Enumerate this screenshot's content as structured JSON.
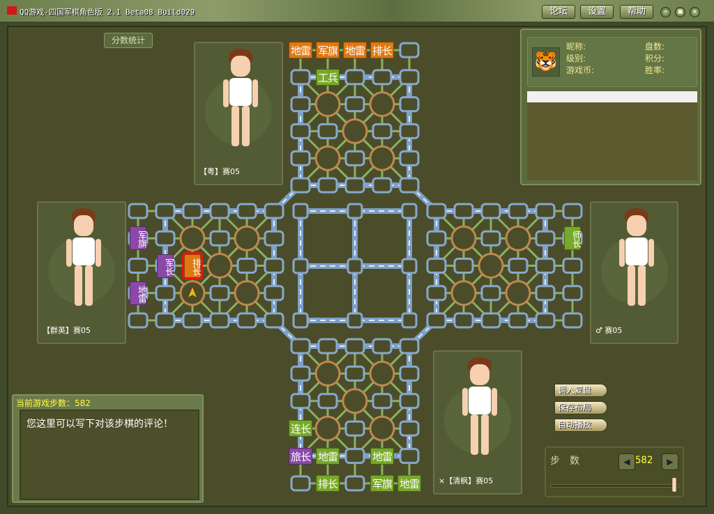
{
  "title": "QQ游戏-四国军棋角色版 2.1 Beta08 Build029",
  "top_buttons": [
    "论坛",
    "设置",
    "帮助"
  ],
  "window_controls": {
    "minimize": "−",
    "restore": "▣",
    "close": "×"
  },
  "score_button": "分数统计",
  "players": {
    "top": {
      "name": "【粤】赛05"
    },
    "left": {
      "name": "【群英】赛05"
    },
    "right": {
      "name": "♂ 赛05"
    },
    "bottom": {
      "name": "×【清枫】赛05"
    }
  },
  "info_panel": {
    "nickname": "昵称:",
    "games": "盘数:",
    "level": "级别:",
    "score": "积分:",
    "coins": "游戏币:",
    "winrate": "胜率:",
    "pet_icon": "🐯"
  },
  "comment": {
    "header": "当前游戏步数：582",
    "text": "您这里可以写下对该步棋的评论！"
  },
  "actions": [
    "调入复盘",
    "保存布局",
    "自动播放"
  ],
  "steps": {
    "label": "步　数",
    "value": "582",
    "prev": "◀",
    "next": "▶",
    "progress": 1.0
  },
  "colors": {
    "orange": "#e07810",
    "purple": "#8a48a8",
    "green": "#78a828"
  },
  "pieces": [
    {
      "label": "地雷",
      "color": "orange",
      "region": "top",
      "c": 0,
      "r": 0
    },
    {
      "label": "军旗",
      "color": "orange",
      "region": "top",
      "c": 1,
      "r": 0
    },
    {
      "label": "地雷",
      "color": "orange",
      "region": "top",
      "c": 2,
      "r": 0
    },
    {
      "label": "排长",
      "color": "orange",
      "region": "top",
      "c": 3,
      "r": 0
    },
    {
      "label": "工兵",
      "color": "green",
      "region": "top",
      "c": 1,
      "r": 1
    },
    {
      "label": "军旗",
      "color": "purple",
      "region": "left",
      "c": 0,
      "r": 1
    },
    {
      "label": "军长",
      "color": "purple",
      "region": "left",
      "c": 1,
      "r": 2
    },
    {
      "label": "地雷",
      "color": "purple",
      "region": "left",
      "c": 0,
      "r": 3
    },
    {
      "label": "排长",
      "color": "orange",
      "region": "left",
      "c": 2,
      "r": 2,
      "selected": true
    },
    {
      "label": "师长",
      "color": "green",
      "region": "right",
      "c": 5,
      "r": 1
    },
    {
      "label": "连长",
      "color": "green",
      "region": "bottom",
      "c": 0,
      "r": 3
    },
    {
      "label": "旅长",
      "color": "purple",
      "region": "bottom",
      "c": 0,
      "r": 4
    },
    {
      "label": "地雷",
      "color": "green",
      "region": "bottom",
      "c": 1,
      "r": 4
    },
    {
      "label": "地雷",
      "color": "green",
      "region": "bottom",
      "c": 3,
      "r": 4
    },
    {
      "label": "排长",
      "color": "green",
      "region": "bottom",
      "c": 1,
      "r": 5
    },
    {
      "label": "军旗",
      "color": "green",
      "region": "bottom",
      "c": 3,
      "r": 5
    },
    {
      "label": "地雷",
      "color": "green",
      "region": "bottom",
      "c": 4,
      "r": 5
    }
  ]
}
